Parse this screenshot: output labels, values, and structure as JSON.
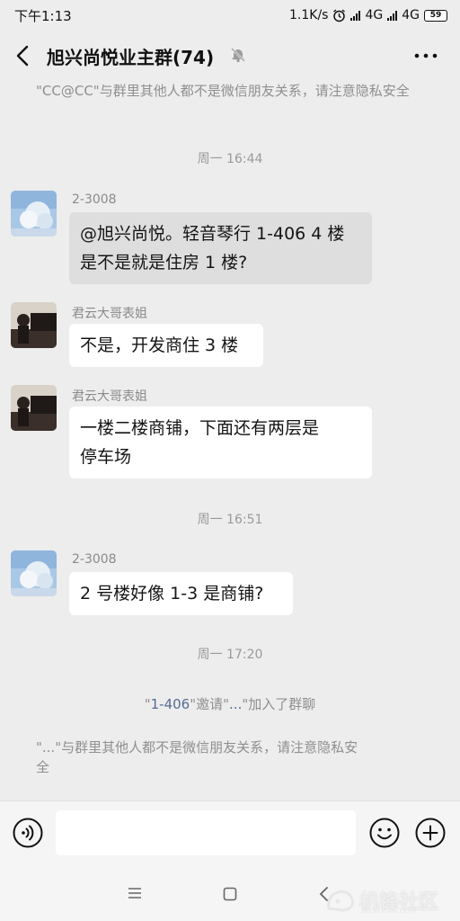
{
  "status_bar": {
    "time": "下午1:13",
    "speed": "1.1K/s",
    "net1": "4G",
    "net2": "4G",
    "battery": "59",
    "icons": [
      "alarm-icon",
      "signal-icon",
      "hd-icon",
      "battery-icon"
    ]
  },
  "header": {
    "title": "旭兴尚悦业主群(74)",
    "icons": [
      "back-icon",
      "mute-icon",
      "more-icon"
    ]
  },
  "notice_top": "\"CC@CC\"与群里其他人都不是微信朋友关系，请注意隐私安全",
  "messages": [
    {
      "type": "time",
      "text": "周一 16:44"
    },
    {
      "type": "msg",
      "sender": "2-3008",
      "lines": [
        "@旭兴尚悦。轻音琴行 1-406 4 楼",
        "是不是就是住房 1 楼?"
      ]
    },
    {
      "type": "msg",
      "sender": "君云大哥表姐",
      "lines": [
        "不是，开发商住 3 楼"
      ]
    },
    {
      "type": "msg",
      "sender": "君云大哥表姐",
      "lines": [
        "一楼二楼商铺，下面还有两层是",
        "停车场"
      ]
    },
    {
      "type": "time",
      "text": "周一 16:51"
    },
    {
      "type": "msg",
      "sender": "2-3008",
      "lines": [
        "2 号楼好像 1-3 是商铺?"
      ]
    },
    {
      "type": "time",
      "text": "周一 17:20"
    }
  ],
  "invite": {
    "q1": "\"",
    "name": "1-406",
    "q2": "\"邀请\"",
    "inviter": "...",
    "rest": "\"加入了群聊"
  },
  "notice_bottom": {
    "line1": "\"...\"与群里其他人都不是微信朋友关系，请注意隐私安",
    "line2": "全"
  },
  "input_bar": {
    "placeholder": "",
    "icons": [
      "voice-icon",
      "emoji-icon",
      "plus-icon"
    ]
  },
  "nav": {
    "icons": [
      "nav-menu-icon",
      "nav-home-icon",
      "nav-back-icon"
    ]
  },
  "watermark": {
    "text": "机锋社区",
    "sub": "BBS.GFAN.COM"
  },
  "colors": {
    "background": "#ededed",
    "bubble_white": "#ffffff",
    "bubble_grey": "#dedede",
    "link": "#576b95"
  }
}
